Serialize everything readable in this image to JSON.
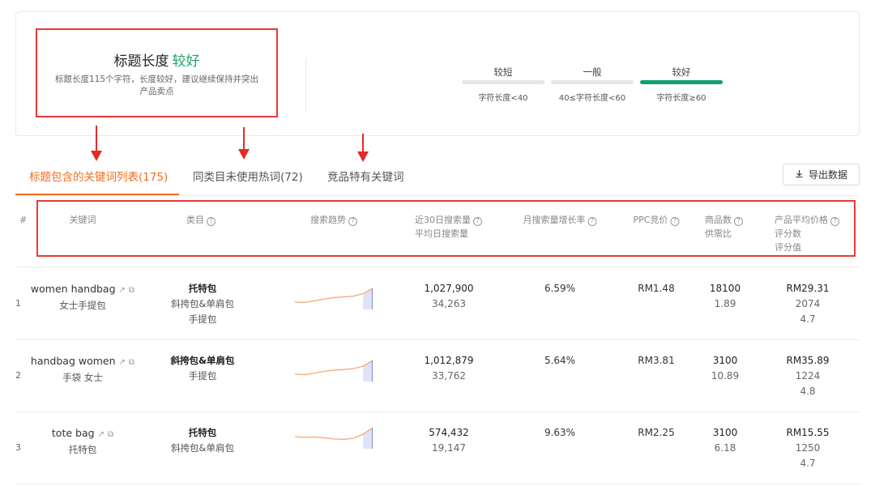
{
  "summary": {
    "title_prefix": "标题长度",
    "title_status": "较好",
    "description": "标题长度115个字符，长度较好，建议继续保持并突出产品卖点",
    "levels": [
      {
        "name": "较短",
        "condition": "字符长度<40",
        "active": false
      },
      {
        "name": "一般",
        "condition": "40≤字符长度<60",
        "active": false
      },
      {
        "name": "较好",
        "condition": "字符长度≥60",
        "active": true
      }
    ]
  },
  "tabs": [
    {
      "label": "标题包含的关键词列表(175)",
      "active": true
    },
    {
      "label": "同类目未使用热词(72)",
      "active": false
    },
    {
      "label": "竞品特有关键词",
      "active": false
    }
  ],
  "toolbar": {
    "export_label": "导出数据",
    "export_icon": "download-icon"
  },
  "columns": {
    "index": "#",
    "keyword": "关键词",
    "category": "类目",
    "trend": "搜索趋势",
    "search_volume": "近30日搜索量",
    "daily_search": "平均日搜索量",
    "growth": "月搜索量增长率",
    "ppc": "PPC竞价",
    "product_count": "商品数",
    "supply_demand": "供需比",
    "avg_price": "产品平均价格",
    "review_count": "评分数",
    "rating": "评分值"
  },
  "rows": [
    {
      "index": "1",
      "keyword": "women handbag",
      "keyword_cn": "女士手提包",
      "category_main": "托特包",
      "category_sub1": "斜挎包&单肩包",
      "category_sub2": "手提包",
      "search_volume": "1,027,900",
      "daily_search": "34,263",
      "growth": "6.59%",
      "ppc": "RM1.48",
      "product_count": "18100",
      "supply_demand": "1.89",
      "avg_price": "RM29.31",
      "review_count": "2074",
      "rating": "4.7",
      "trend": [
        0.3,
        0.28,
        0.36,
        0.45,
        0.52,
        0.56,
        0.6,
        0.72,
        1.0
      ]
    },
    {
      "index": "2",
      "keyword": "handbag women",
      "keyword_cn": "手袋 女士",
      "category_main": "斜挎包&单肩包",
      "category_sub1": "手提包",
      "category_sub2": "",
      "search_volume": "1,012,879",
      "daily_search": "33,762",
      "growth": "5.64%",
      "ppc": "RM3.81",
      "product_count": "3100",
      "supply_demand": "10.89",
      "avg_price": "RM35.89",
      "review_count": "1224",
      "rating": "4.8",
      "trend": [
        0.3,
        0.27,
        0.34,
        0.44,
        0.5,
        0.53,
        0.58,
        0.7,
        1.0
      ]
    },
    {
      "index": "3",
      "keyword": "tote bag",
      "keyword_cn": "托特包",
      "category_main": "托特包",
      "category_sub1": "斜挎包&单肩包",
      "category_sub2": "",
      "search_volume": "574,432",
      "daily_search": "19,147",
      "growth": "9.63%",
      "ppc": "RM2.25",
      "product_count": "3100",
      "supply_demand": "6.18",
      "avg_price": "RM15.55",
      "review_count": "1250",
      "rating": "4.7",
      "trend": [
        0.55,
        0.5,
        0.52,
        0.48,
        0.42,
        0.4,
        0.45,
        0.66,
        1.0
      ]
    }
  ],
  "colors": {
    "accent": "#f26e1d",
    "good": "#20a46b",
    "highlight": "#e83a36",
    "trend_line": "#f5a36a",
    "trend_fill": "#dfe3f7"
  }
}
